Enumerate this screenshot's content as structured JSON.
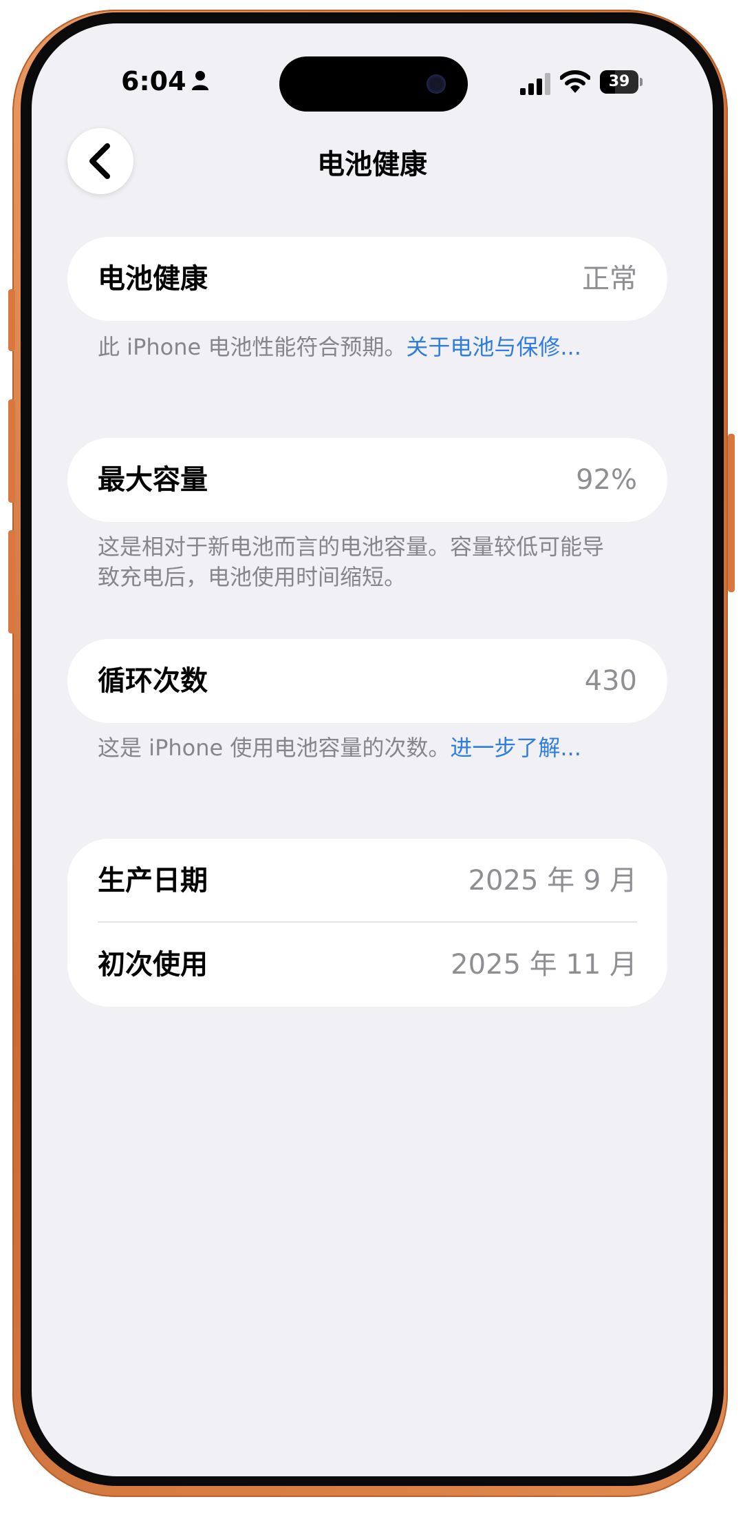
{
  "status_bar": {
    "time": "6:04",
    "battery_level": "39",
    "icons": [
      "person-icon",
      "signal-icon",
      "wifi-icon",
      "battery-icon"
    ]
  },
  "nav": {
    "title": "电池健康",
    "back_icon": "chevron-left-icon"
  },
  "sections": {
    "health": {
      "label": "电池健康",
      "value": "正常",
      "footnote": "此 iPhone 电池性能符合预期。",
      "link": "关于电池与保修..."
    },
    "capacity": {
      "label": "最大容量",
      "value": "92%",
      "footnote": "这是相对于新电池而言的电池容量。容量较低可能导致充电后，电池使用时间缩短。"
    },
    "cycles": {
      "label": "循环次数",
      "value": "430",
      "footnote": "这是 iPhone 使用电池容量的次数。",
      "link": "进一步了解..."
    },
    "dates": {
      "manufacture_label": "生产日期",
      "manufacture_value": "2025 年 9 月",
      "first_use_label": "初次使用",
      "first_use_value": "2025 年 11 月"
    }
  },
  "colors": {
    "background": "#f0f0f5",
    "card": "#ffffff",
    "link": "#2f7de0",
    "secondary_text": "#8e8e93",
    "frame": "#d9773f"
  }
}
